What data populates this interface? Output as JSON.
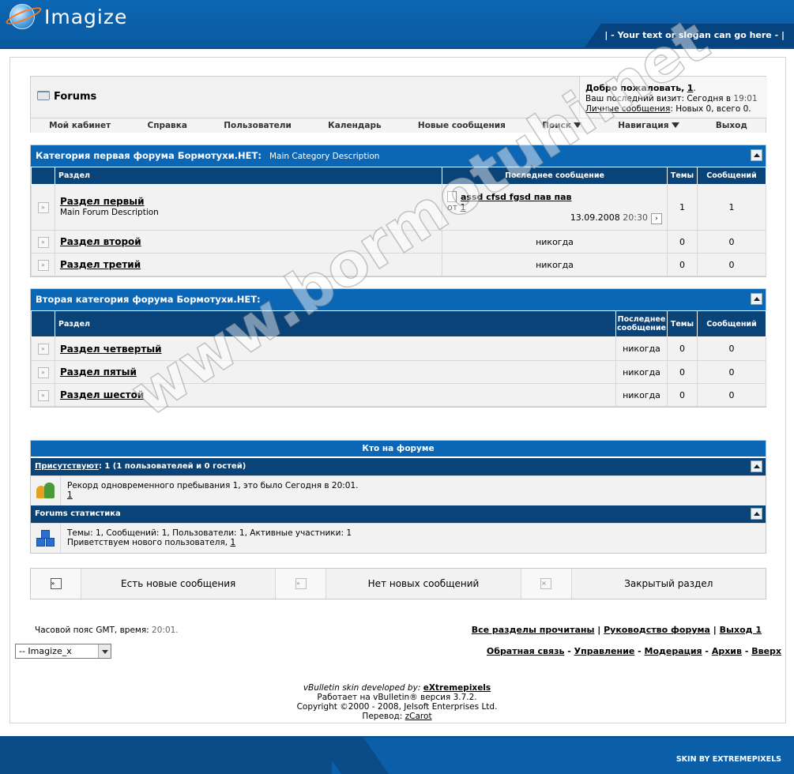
{
  "header": {
    "logo_text": "Imagize",
    "slogan": "| - Your text or slogan can go here - |"
  },
  "navbar": {
    "title": "Forums",
    "welcome": {
      "greeting": "Добро пожаловать,",
      "user": "1",
      "last_visit_label": "Ваш последний визит: Сегодня в",
      "last_visit_time": "19:01",
      "pm_link": "Личные сообщения",
      "pm_status": ": Новых 0, всего 0."
    },
    "links": [
      "Мой кабинет",
      "Справка",
      "Пользователи",
      "Календарь",
      "Новые сообщения",
      "Поиск",
      "Навигация",
      "Выход"
    ]
  },
  "category1": {
    "title": "Категория первая форума Бормотухи.НЕТ:",
    "description": "Main Category Description",
    "columns": {
      "forum": "Раздел",
      "last_post": "Последнее сообщение",
      "threads": "Темы",
      "posts": "Сообщений"
    },
    "forums": [
      {
        "name": "Раздел первый",
        "description": "Main Forum Description",
        "last_post_title": "assd cfsd fgsd пав пав",
        "last_post_from_label": "от",
        "last_post_user": "1",
        "last_post_date": "13.09.2008",
        "last_post_time": "20:30",
        "threads": "1",
        "posts": "1"
      },
      {
        "name": "Раздел второй",
        "last_post": "никогда",
        "threads": "0",
        "posts": "0"
      },
      {
        "name": "Раздел третий",
        "last_post": "никогда",
        "threads": "0",
        "posts": "0"
      }
    ]
  },
  "category2": {
    "title": "Вторая категория форума Бормотухи.НЕТ:",
    "columns": {
      "forum": "Раздел",
      "last_post_line1": "Последнее",
      "last_post_line2": "сообщение",
      "threads": "Темы",
      "posts": "Сообщений"
    },
    "forums": [
      {
        "name": "Раздел четвертый",
        "last_post": "никогда",
        "threads": "0",
        "posts": "0"
      },
      {
        "name": "Раздел пятый",
        "last_post": "никогда",
        "threads": "0",
        "posts": "0"
      },
      {
        "name": "Раздел шестой",
        "last_post": "никогда",
        "threads": "0",
        "posts": "0"
      }
    ]
  },
  "online": {
    "heading": "Кто на форуме",
    "present_link": "Присутствуют",
    "present_text": ": 1 (1 пользователей и 0 гостей)",
    "record_text": "Рекорд одновременного пребывания 1, это было Сегодня в 20:01.",
    "record_user": "1",
    "stats_heading": "Forums статистика",
    "stats_text": "Темы: 1, Сообщений: 1, Пользователи: 1, Активные участники: 1",
    "welcome_new_text": "Приветствуем нового пользователя,",
    "welcome_new_user": "1"
  },
  "legend": {
    "new_posts": "Есть новые сообщения",
    "no_new_posts": "Нет новых сообщений",
    "closed": "Закрытый раздел"
  },
  "footer": {
    "timezone_label": "Часовой пояс GMT, время:",
    "timezone_time": "20:01.",
    "links1": [
      "Все разделы прочитаны",
      "Руководство форума",
      "Выход 1"
    ],
    "links2": [
      "Обратная связь",
      "Управление",
      "Модерация",
      "Архив",
      "Вверх"
    ],
    "style_select": "-- Imagize_x",
    "credit_skin": "vBulletin skin developed by:",
    "credit_skin_author": "eXtremepixels",
    "powered": "Работает на vBulletin® версия 3.7.2.",
    "copyright": "Copyright ©2000 - 2008, Jelsoft Enterprises Ltd.",
    "translation_label": "Перевод:",
    "translation_author": "zCarot",
    "skin_by": "SKIN BY EXTREMEPIXELS"
  },
  "watermark": "www.bormotuhi.net",
  "colors": {
    "header_blue": "#0b5fa8",
    "category_blue": "#0b66b5",
    "column_header": "#0a4378",
    "row_bg": "#f2f2f2"
  }
}
